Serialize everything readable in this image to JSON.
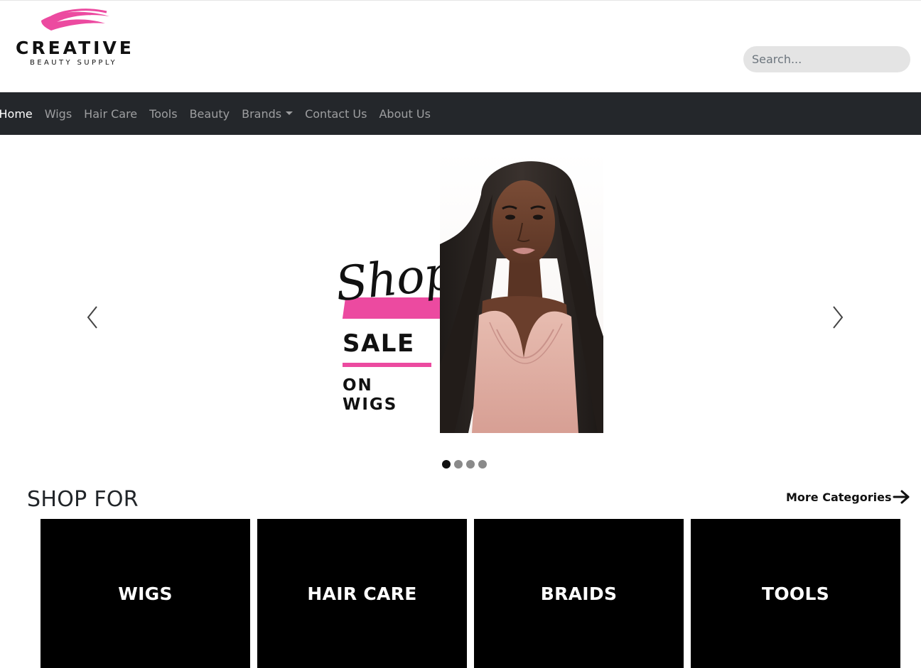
{
  "brand": {
    "name": "CREATIVE",
    "tagline": "BEAUTY SUPPLY",
    "accent_color": "#ec4aa0"
  },
  "search": {
    "placeholder": "Search..."
  },
  "nav": {
    "items": [
      {
        "label": "Home",
        "active": true
      },
      {
        "label": "Wigs"
      },
      {
        "label": "Hair Care"
      },
      {
        "label": "Tools"
      },
      {
        "label": "Beauty"
      },
      {
        "label": "Brands",
        "dropdown": true
      },
      {
        "label": "Contact Us"
      },
      {
        "label": "About Us"
      }
    ]
  },
  "carousel": {
    "slide": {
      "script_text": "Shop",
      "headline": "SALE",
      "subline": "ON\nWIGS"
    },
    "prev_icon": "chevron-left-icon",
    "next_icon": "chevron-right-icon",
    "slide_count": 4,
    "active_index": 0
  },
  "shop_for": {
    "title": "SHOP FOR",
    "more_link": "More Categories",
    "more_icon": "arrow-right-icon",
    "categories": [
      "WIGS",
      "HAIR CARE",
      "BRAIDS",
      "TOOLS"
    ]
  }
}
